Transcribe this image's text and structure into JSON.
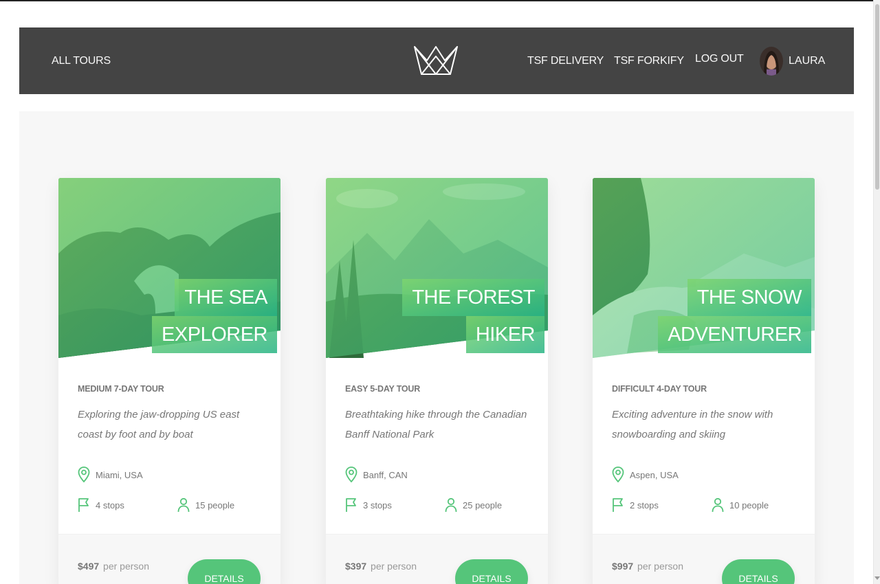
{
  "nav": {
    "all_tours": "ALL TOURS",
    "delivery": "TSF DELIVERY",
    "forkify": "TSF FORKIFY",
    "logout": "LOG OUT",
    "user_name": "LAURA"
  },
  "tours": [
    {
      "title_line1": "THE SEA",
      "title_line2": "EXPLORER",
      "sub_heading": "MEDIUM 7-DAY TOUR",
      "summary": "Exploring the jaw-dropping US east coast by foot and by boat",
      "location": "Miami, USA",
      "stops": "4 stops",
      "people": "15 people",
      "price": "$497",
      "price_suffix": "per person",
      "button": "DETAILS"
    },
    {
      "title_line1": "THE FOREST",
      "title_line2": "HIKER",
      "sub_heading": "EASY 5-DAY TOUR",
      "summary": "Breathtaking hike through the Canadian Banff National Park",
      "location": "Banff, CAN",
      "stops": "3 stops",
      "people": "25 people",
      "price": "$397",
      "price_suffix": "per person",
      "button": "DETAILS"
    },
    {
      "title_line1": "THE SNOW",
      "title_line2": "ADVENTURER",
      "sub_heading": "DIFFICULT 4-DAY TOUR",
      "summary": "Exciting adventure in the snow with snowboarding and skiing",
      "location": "Aspen, USA",
      "stops": "2 stops",
      "people": "10 people",
      "price": "$997",
      "price_suffix": "per person",
      "button": "DETAILS"
    }
  ],
  "colors": {
    "header_bg": "#444444",
    "primary_green": "#55c57a",
    "gradient_light": "#7ed56f",
    "gradient_dark": "#28b485"
  }
}
